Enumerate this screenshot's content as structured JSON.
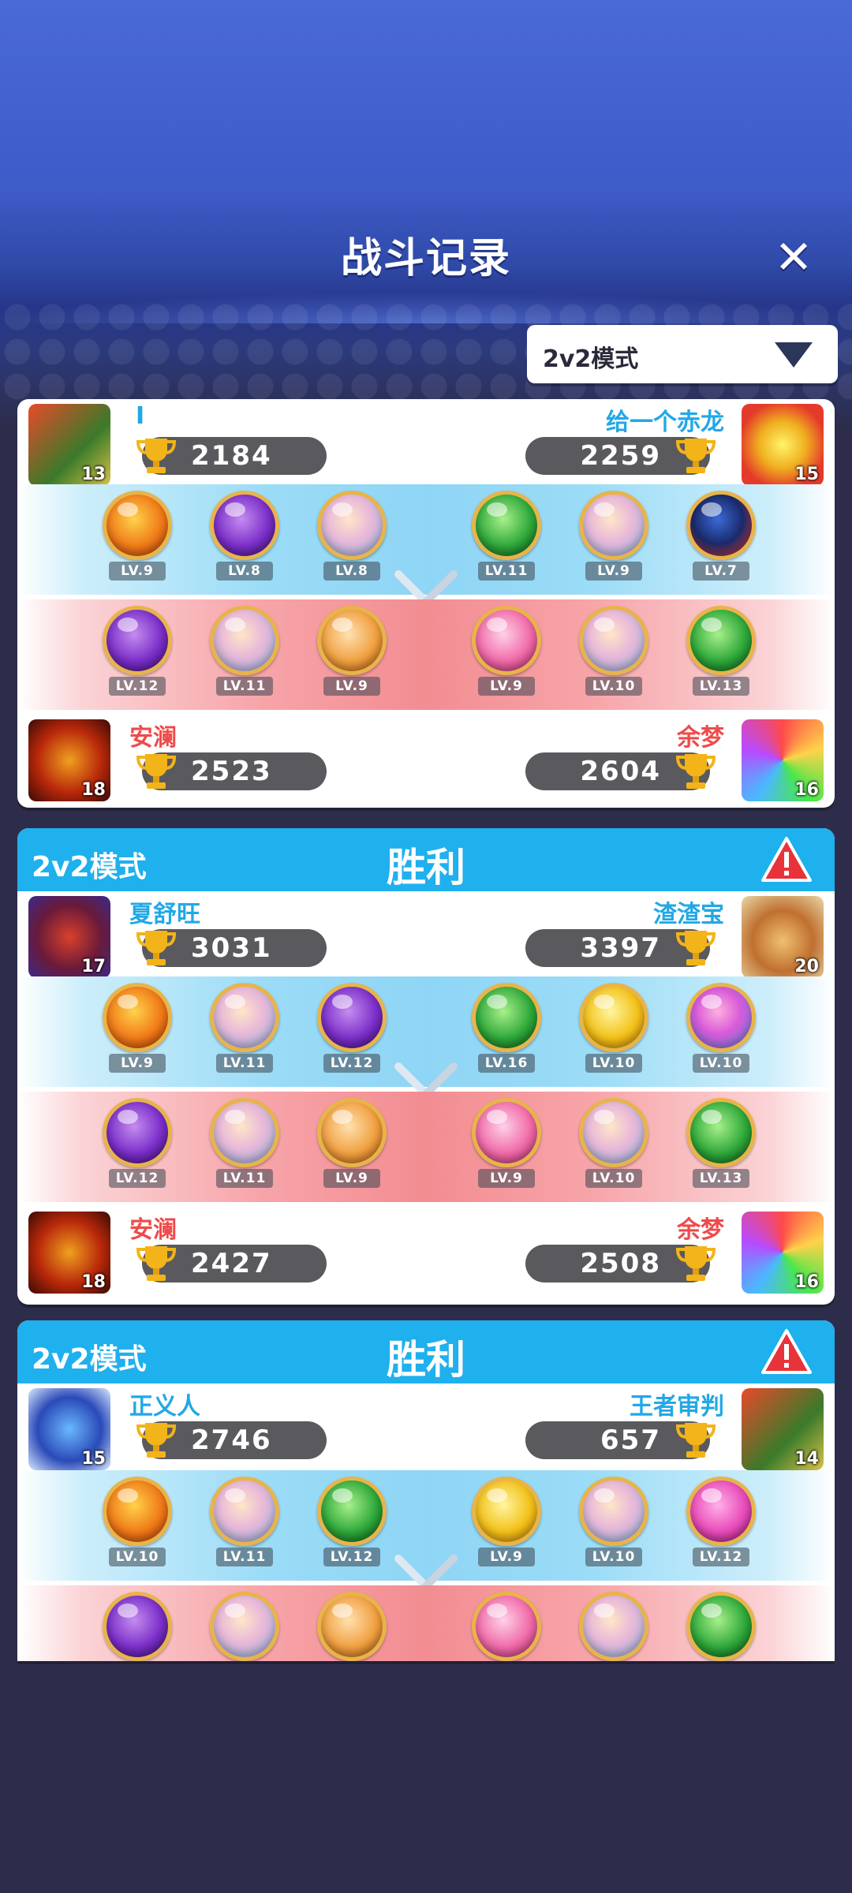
{
  "header": {
    "title": "战斗记录",
    "close_symbol": "✕"
  },
  "mode_filter": {
    "selected": "2v2模式"
  },
  "colors": {
    "accent_blue": "#1fb0ee",
    "win_red": "#f04a4a",
    "score_gray": "#5a5a5e"
  },
  "records": [
    {
      "mode": "",
      "result": "",
      "top": {
        "left": {
          "name": "I",
          "score": "2184",
          "avatar_level": "13"
        },
        "right": {
          "name": "给一个赤龙",
          "score": "2259",
          "avatar_level": "15"
        }
      },
      "top_pets_left": [
        "LV.9",
        "LV.8",
        "LV.8"
      ],
      "top_pets_right": [
        "LV.11",
        "LV.9",
        "LV.7"
      ],
      "bottom_pets_left": [
        "LV.12",
        "LV.11",
        "LV.9"
      ],
      "bottom_pets_right": [
        "LV.9",
        "LV.10",
        "LV.13"
      ],
      "bottom": {
        "left": {
          "name": "安澜",
          "score": "2523",
          "avatar_level": "18"
        },
        "right": {
          "name": "余梦",
          "score": "2604",
          "avatar_level": "16"
        }
      }
    },
    {
      "mode": "2v2模式",
      "result": "胜利",
      "top": {
        "left": {
          "name": "夏舒旺",
          "score": "3031",
          "avatar_level": "17"
        },
        "right": {
          "name": "渣渣宝",
          "score": "3397",
          "avatar_level": "20"
        }
      },
      "top_pets_left": [
        "LV.9",
        "LV.11",
        "LV.12"
      ],
      "top_pets_right": [
        "LV.16",
        "LV.10",
        "LV.10"
      ],
      "bottom_pets_left": [
        "LV.12",
        "LV.11",
        "LV.9"
      ],
      "bottom_pets_right": [
        "LV.9",
        "LV.10",
        "LV.13"
      ],
      "bottom": {
        "left": {
          "name": "安澜",
          "score": "2427",
          "avatar_level": "18"
        },
        "right": {
          "name": "余梦",
          "score": "2508",
          "avatar_level": "16"
        }
      }
    },
    {
      "mode": "2v2模式",
      "result": "胜利",
      "top": {
        "left": {
          "name": "正义人",
          "score": "2746",
          "avatar_level": "15"
        },
        "right": {
          "name": "王者审判",
          "score": "657",
          "avatar_level": "14"
        }
      },
      "top_pets_left": [
        "LV.10",
        "LV.11",
        "LV.12"
      ],
      "top_pets_right": [
        "LV.9",
        "LV.10",
        "LV.12"
      ]
    }
  ]
}
